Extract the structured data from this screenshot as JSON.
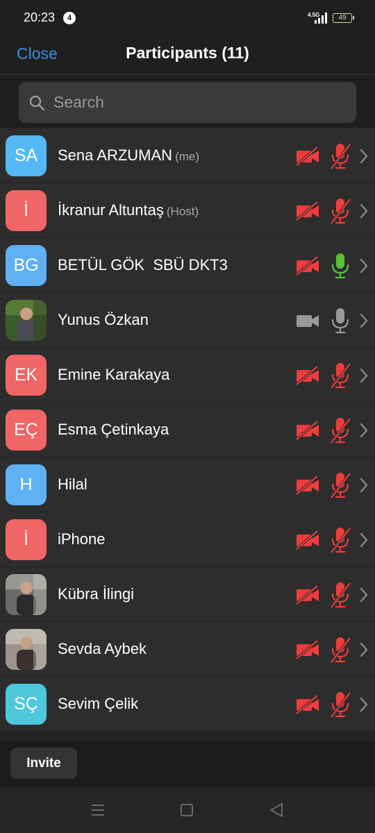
{
  "status_bar": {
    "time": "20:23",
    "notification_count": "4",
    "network": "4.5G",
    "battery": "49"
  },
  "header": {
    "close_label": "Close",
    "title": "Participants (11)"
  },
  "search": {
    "placeholder": "Search"
  },
  "participants": [
    {
      "name": "Sena ARZUMAN",
      "tag": "(me)",
      "initials": "SA",
      "avatar_color": "#55b8f5",
      "video": "off",
      "audio": "muted"
    },
    {
      "name": "İkranur Altuntaş",
      "tag": "(Host)",
      "initials": "İ",
      "avatar_color": "#f06565",
      "video": "off",
      "audio": "muted"
    },
    {
      "name": "BETÜL GÖK  SBÜ DKT3",
      "tag": "",
      "initials": "BG",
      "avatar_color": "#5fb0f5",
      "video": "off",
      "audio": "active"
    },
    {
      "name": "Yunus Özkan",
      "tag": "",
      "initials": "",
      "avatar": "photo",
      "video": "on",
      "audio": "on"
    },
    {
      "name": "Emine Karakaya",
      "tag": "",
      "initials": "EK",
      "avatar_color": "#f06565",
      "video": "off",
      "audio": "muted"
    },
    {
      "name": "Esma Çetinkaya",
      "tag": "",
      "initials": "EÇ",
      "avatar_color": "#f06565",
      "video": "off",
      "audio": "muted"
    },
    {
      "name": "Hilal",
      "tag": "",
      "initials": "H",
      "avatar_color": "#5fb0f5",
      "video": "off",
      "audio": "muted"
    },
    {
      "name": "iPhone",
      "tag": "",
      "initials": "İ",
      "avatar_color": "#f06565",
      "video": "off",
      "audio": "muted"
    },
    {
      "name": "Kübra İlingi",
      "tag": "",
      "initials": "",
      "avatar": "photo",
      "video": "off",
      "audio": "muted"
    },
    {
      "name": "Sevda Aybek",
      "tag": "",
      "initials": "",
      "avatar": "photo",
      "video": "off",
      "audio": "muted"
    },
    {
      "name": "Sevim Çelik",
      "tag": "",
      "initials": "SÇ",
      "avatar_color": "#4fc8dc",
      "video": "off",
      "audio": "muted"
    }
  ],
  "footer": {
    "invite_label": "Invite"
  },
  "colors": {
    "accent": "#3b8ce8",
    "muted_red": "#f03c3c",
    "active_green": "#5bc236",
    "neutral_gray": "#9a9a9a"
  },
  "icons": [
    "search-icon",
    "video-off-icon",
    "video-icon",
    "mic-off-icon",
    "mic-icon",
    "chevron-right-icon"
  ]
}
